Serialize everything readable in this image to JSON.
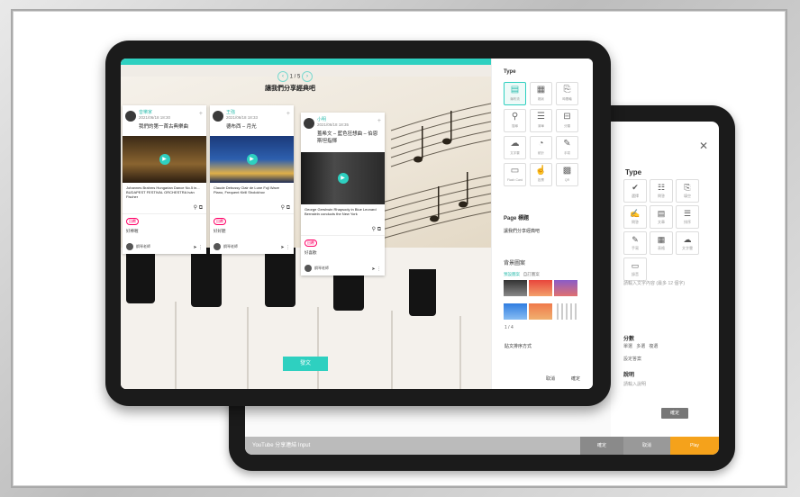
{
  "front": {
    "pager": {
      "prev": "‹",
      "page": "1 / 5",
      "next": "›"
    },
    "board_title": "讓我們分享經典吧",
    "cards": [
      {
        "name": "音樂家",
        "meta": "2021/06/18 18:30",
        "title": "我們的第一首古典樂曲",
        "desc": "Johannes Brahms Hungarian Dance No.5 in... BUDAPEST FESTIVAL ORCHESTRA Iván Fischer",
        "comment": "好棒喔",
        "badge": "回覆",
        "user": "鋼琴老師"
      },
      {
        "name": "王強",
        "meta": "2021/06/18 18:33",
        "title": "德布西 – 月光",
        "desc": "Claude Debussy Clair de Lune Fuji Wave Piano, Frequent Kirill Sholokhov",
        "comment": "好好聽",
        "badge": "回覆",
        "user": "鋼琴老師"
      },
      {
        "name": "小明",
        "meta": "2021/06/18 18:35",
        "title": "蓋希文 – 藍色狂想曲 – 伯恩斯坦指揮",
        "desc": "George Gershwin Rhapsody in Blue Leonard Bernstein conducts the New York",
        "comment": "好喜歡",
        "badge": "回覆",
        "user": "鋼琴老師"
      }
    ],
    "publish_button": "發文",
    "panel": {
      "type_label": "Type",
      "types": [
        {
          "icon": "▤",
          "label": "瀑布流"
        },
        {
          "icon": "▦",
          "label": "格狀"
        },
        {
          "icon": "⎘",
          "label": "時間軸"
        },
        {
          "icon": "⚲",
          "label": "搜尋"
        },
        {
          "icon": "☰",
          "label": "清單"
        },
        {
          "icon": "⊟",
          "label": "分類"
        },
        {
          "icon": "☁",
          "label": "文字雲"
        },
        {
          "icon": "◔",
          "label": "統計"
        },
        {
          "icon": "✎",
          "label": "手寫"
        },
        {
          "icon": "▭",
          "label": "Flash Card"
        },
        {
          "icon": "☝",
          "label": "投票"
        },
        {
          "icon": "▩",
          "label": "QR"
        }
      ],
      "page_label": "Page 標題",
      "page_value": "讓我們分享經典吧",
      "bg_label": "背景圖案",
      "bg_tabs": [
        "預設圖案",
        "自訂圖案"
      ],
      "pagination": "1 / 4",
      "post_mode_label": "貼文排序方式",
      "cancel": "取消",
      "confirm": "確定"
    }
  },
  "back": {
    "close": "✕",
    "type_label": "Type",
    "types": [
      {
        "icon": "✔",
        "label": "選擇"
      },
      {
        "icon": "☷",
        "label": "問答"
      },
      {
        "icon": "⎘",
        "label": "填空"
      },
      {
        "icon": "✍",
        "label": "問答"
      },
      {
        "icon": "▤",
        "label": "文章"
      },
      {
        "icon": "☰",
        "label": "排序"
      },
      {
        "icon": "✎",
        "label": "手寫"
      },
      {
        "icon": "▦",
        "label": "表格"
      },
      {
        "icon": "☁",
        "label": "文字雲"
      },
      {
        "icon": "▭",
        "label": "錄音"
      }
    ],
    "hint": "請輸入文字內容 (最多 12 個字)",
    "score_label": "分數",
    "radio_opts": [
      "單選",
      "多選",
      "複選"
    ],
    "answer_label": "設定答案",
    "note_label": "說明",
    "note_text": "請輸入說明",
    "confirm": "確定",
    "bar_input": "YouTube 分享連結 Input",
    "bar_btn1": "確定",
    "bar_btn2": "取消",
    "bar_btn3": "Play"
  }
}
